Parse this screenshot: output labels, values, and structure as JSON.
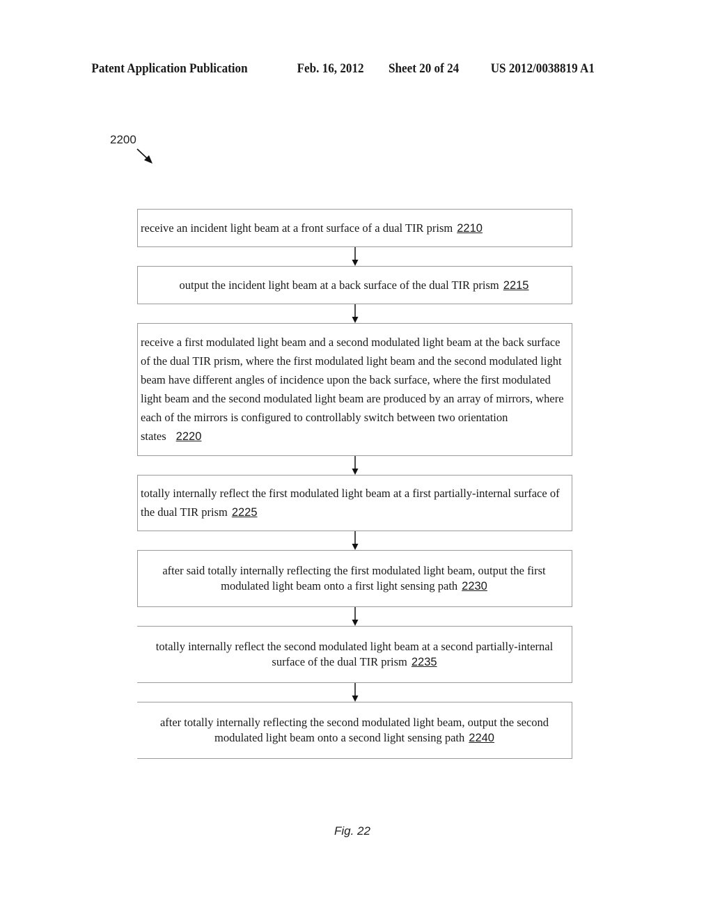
{
  "header": {
    "publication": "Patent Application Publication",
    "date": "Feb. 16, 2012",
    "sheet": "Sheet 20 of 24",
    "number": "US 2012/0038819 A1"
  },
  "figure_ref": "2200",
  "steps": [
    {
      "text": "receive an incident light beam at a front surface of a dual TIR prism",
      "ref": "2210"
    },
    {
      "text": "output the incident light beam at a back surface of the dual TIR prism",
      "ref": "2215"
    },
    {
      "text": "receive a first modulated light beam and a second modulated light beam at the back surface of the dual TIR prism, where the first modulated light beam and the second modulated light beam have different angles of incidence upon the back surface, where the first modulated light beam and the second modulated light beam are produced by an array of mirrors, where each of the mirrors is configured to controllably switch between two orientation states",
      "ref": "2220"
    },
    {
      "text": "totally internally reflect the first modulated light beam at a first partially-internal surface of the dual TIR prism",
      "ref": "2225"
    },
    {
      "text": "after said totally internally reflecting the first modulated light beam, output the first modulated light beam onto a first light sensing path",
      "ref": "2230"
    },
    {
      "text": "totally internally reflect the second modulated light beam at a second partially-internal surface of the dual TIR prism",
      "ref": "2235"
    },
    {
      "text": "after totally internally reflecting the second modulated light beam, output the second modulated light beam onto a second light sensing path",
      "ref": "2240"
    }
  ],
  "figure_caption": "Fig. 22"
}
